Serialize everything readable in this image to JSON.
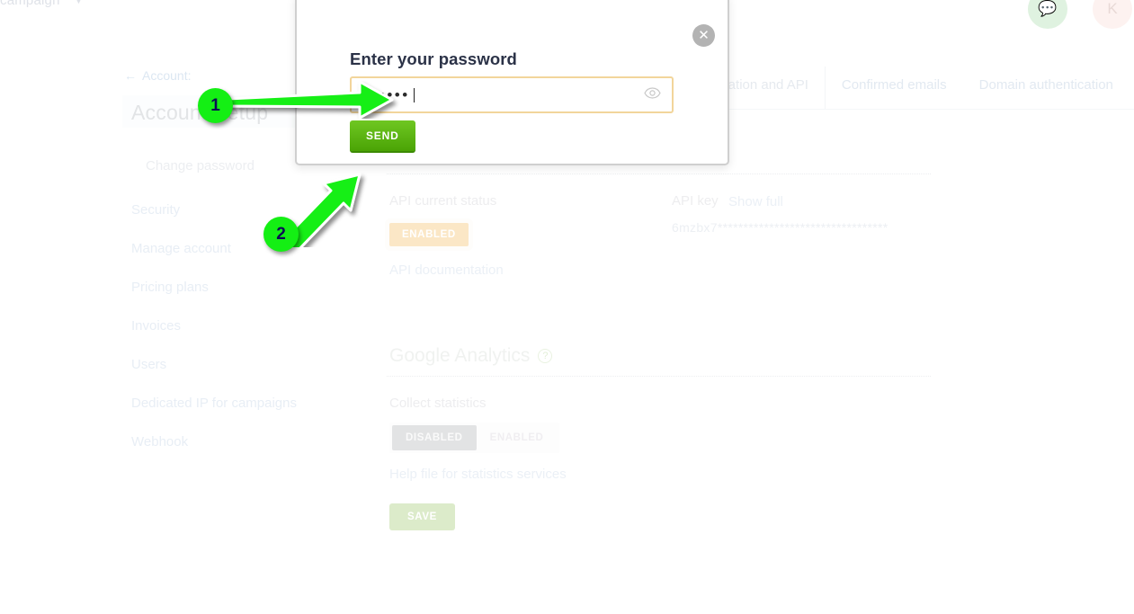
{
  "topbar": {
    "campaign_label": "campaign",
    "caret_icon": "chevron-down-icon",
    "chat_avatar_icon": "chat-bubble-icon",
    "user_avatar_label": "K"
  },
  "tabs": [
    {
      "label": "egration and API",
      "active": true
    },
    {
      "label": "Confirmed emails",
      "active": false
    },
    {
      "label": "Domain authentication",
      "active": false
    }
  ],
  "sidebar": {
    "back_link": "Account:",
    "back_icon": "arrow-left-icon",
    "page_title": "Account Setup",
    "sub_item": "Change password",
    "items": [
      {
        "label": "Security"
      },
      {
        "label": "Manage account"
      },
      {
        "label": "Pricing plans"
      },
      {
        "label": "Invoices"
      },
      {
        "label": "Users"
      },
      {
        "label": "Dedicated IP for campaigns"
      },
      {
        "label": "Webhook"
      }
    ]
  },
  "main": {
    "api_status_label": "API current status",
    "api_status_badge": "ENABLED",
    "api_documentation_link": "API documentation",
    "api_key_label": "API key",
    "api_key_show_full": "Show full",
    "api_key_value": "6mzbx7*********************************",
    "section_title": "Google Analytics",
    "help_icon": "question-mark-icon",
    "collect_statistics_label": "Collect statistics",
    "toggle": {
      "option_off": "DISABLED",
      "option_on": "ENABLED",
      "selected": "DISABLED"
    },
    "help_file_link": "Help file for statistics services",
    "save_label": "SAVE"
  },
  "modal": {
    "heading": "Enter your password",
    "close_icon": "close-icon",
    "password_value": "••••••",
    "password_placeholder": "",
    "reveal_icon": "eye-icon",
    "send_label": "SEND"
  },
  "annotations": [
    {
      "number": "1"
    },
    {
      "number": "2"
    }
  ],
  "colors": {
    "accent_green": "#14ef14",
    "send_green": "#4aa305",
    "badge_orange": "#fbe7c6",
    "input_border": "#f2d59b"
  }
}
